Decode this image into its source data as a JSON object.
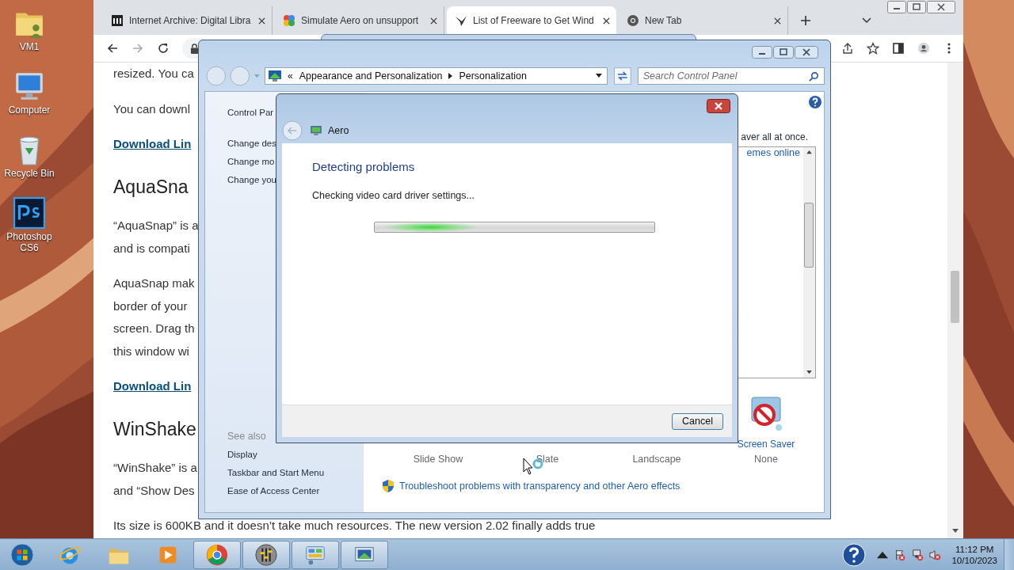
{
  "desktop": {
    "icons": [
      {
        "kind": "user-folder",
        "label": "VM1"
      },
      {
        "kind": "computer",
        "label": "Computer"
      },
      {
        "kind": "recycle-bin",
        "label": "Recycle Bin"
      },
      {
        "kind": "photoshop",
        "label": "Photoshop CS6"
      }
    ]
  },
  "browser": {
    "tabs": [
      {
        "kind": "archive",
        "title": "Internet Archive: Digital Libra",
        "selected": false
      },
      {
        "kind": "puzzle",
        "title": "Simulate Aero on unsupport",
        "selected": false
      },
      {
        "kind": "bird",
        "title": "List of Freeware to Get Wind",
        "selected": true
      },
      {
        "kind": "chrome",
        "title": "New Tab",
        "selected": false
      }
    ],
    "page": [
      {
        "kind": "paragraph",
        "lines": [
          "resized. You ca"
        ]
      },
      {
        "kind": "paragraph",
        "lines": [
          "You can downl"
        ]
      },
      {
        "kind": "link",
        "text": "Download Lin"
      },
      {
        "kind": "heading",
        "text": "AquaSna"
      },
      {
        "kind": "paragraph",
        "lines": [
          "“AquaSnap” is a",
          "and is compati"
        ]
      },
      {
        "kind": "paragraph",
        "lines": [
          "AquaSnap mak",
          "border of your",
          "screen. Drag th",
          "this window wi"
        ]
      },
      {
        "kind": "link",
        "text": "Download Lin"
      },
      {
        "kind": "heading",
        "text": "WinShake"
      },
      {
        "kind": "paragraph",
        "lines": [
          "“WinShake” is a",
          "and “Show Des"
        ]
      },
      {
        "kind": "paragraph",
        "lines": [
          "Its size is 600KB and it doesn’t take much resources. The new version 2.02 finally adds true"
        ]
      }
    ]
  },
  "control_panel": {
    "overflow": "«",
    "breadcrumb": [
      "Appearance and Personalization",
      "Personalization"
    ],
    "search": {
      "placeholder": "Search Control Panel"
    },
    "sidebar": {
      "title": "Control Par",
      "links": [
        "Change des",
        "Change mo",
        "Change you"
      ],
      "see_also_heading": "See also",
      "see_also": [
        "Display",
        "Taskbar and Start Menu",
        "Ease of Access Center"
      ]
    },
    "description": "aver all at once.",
    "themes_link": "emes online",
    "items": [
      {
        "value": "Slide Show"
      },
      {
        "value": "Slate"
      },
      {
        "value": "Landscape"
      },
      {
        "label": "Screen Saver",
        "value": "None"
      }
    ],
    "troubleshoot_link": "Troubleshoot problems with transparency and other Aero effects"
  },
  "dialog": {
    "title": "Aero",
    "heading": "Detecting problems",
    "status": "Checking video card driver settings...",
    "buttons": [
      "Cancel"
    ]
  },
  "taskbar": {
    "apps": [
      {
        "kind": "start",
        "running": false
      },
      {
        "kind": "ie",
        "running": false
      },
      {
        "kind": "folder",
        "running": false
      },
      {
        "kind": "media",
        "running": false
      },
      {
        "kind": "chrome",
        "running": true
      },
      {
        "kind": "mixer",
        "running": true
      },
      {
        "kind": "control-panel",
        "running": true
      },
      {
        "kind": "monitor",
        "running": true
      }
    ],
    "clock": {
      "time": "11:12 PM",
      "date": "10/10/2023"
    }
  }
}
